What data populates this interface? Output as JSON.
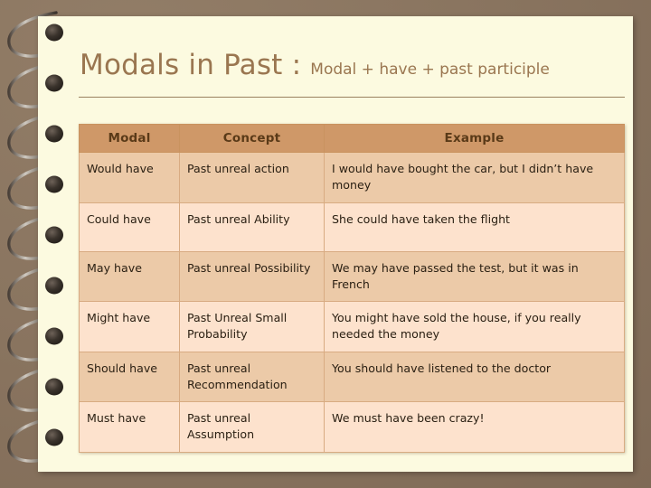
{
  "slide": {
    "background_color": "#8a7560",
    "page_color": "#fcfae0",
    "binding": "spiral-wire-binding"
  },
  "title": {
    "main": "Modals in Past : ",
    "subtitle": "Modal + have + past participle",
    "color": "#9a7650"
  },
  "table": {
    "header_color": "#cf9868",
    "row_dark_color": "#eccaa8",
    "row_light_color": "#fde2cd",
    "columns": [
      "Modal",
      "Concept",
      "Example"
    ],
    "rows": [
      {
        "modal": "Would have",
        "concept": "Past unreal action",
        "example": "I would have bought the car, but I didn’t have money",
        "shade": "dark"
      },
      {
        "modal": "Could have",
        "concept": "Past unreal Ability",
        "example": "She could have taken the flight",
        "shade": "light"
      },
      {
        "modal": "May have",
        "concept": "Past unreal Possibility",
        "example": "We may have passed the test, but it was in French",
        "shade": "dark"
      },
      {
        "modal": "Might have",
        "concept": "Past Unreal Small Probability",
        "example": "You might have sold the house, if you really needed the money",
        "shade": "light"
      },
      {
        "modal": "Should have",
        "concept": "Past unreal Recommendation",
        "example": "You should have listened to the doctor",
        "shade": "dark"
      },
      {
        "modal": "Must have",
        "concept": "Past unreal Assumption",
        "example": "We must have been crazy!",
        "shade": "light"
      }
    ]
  }
}
